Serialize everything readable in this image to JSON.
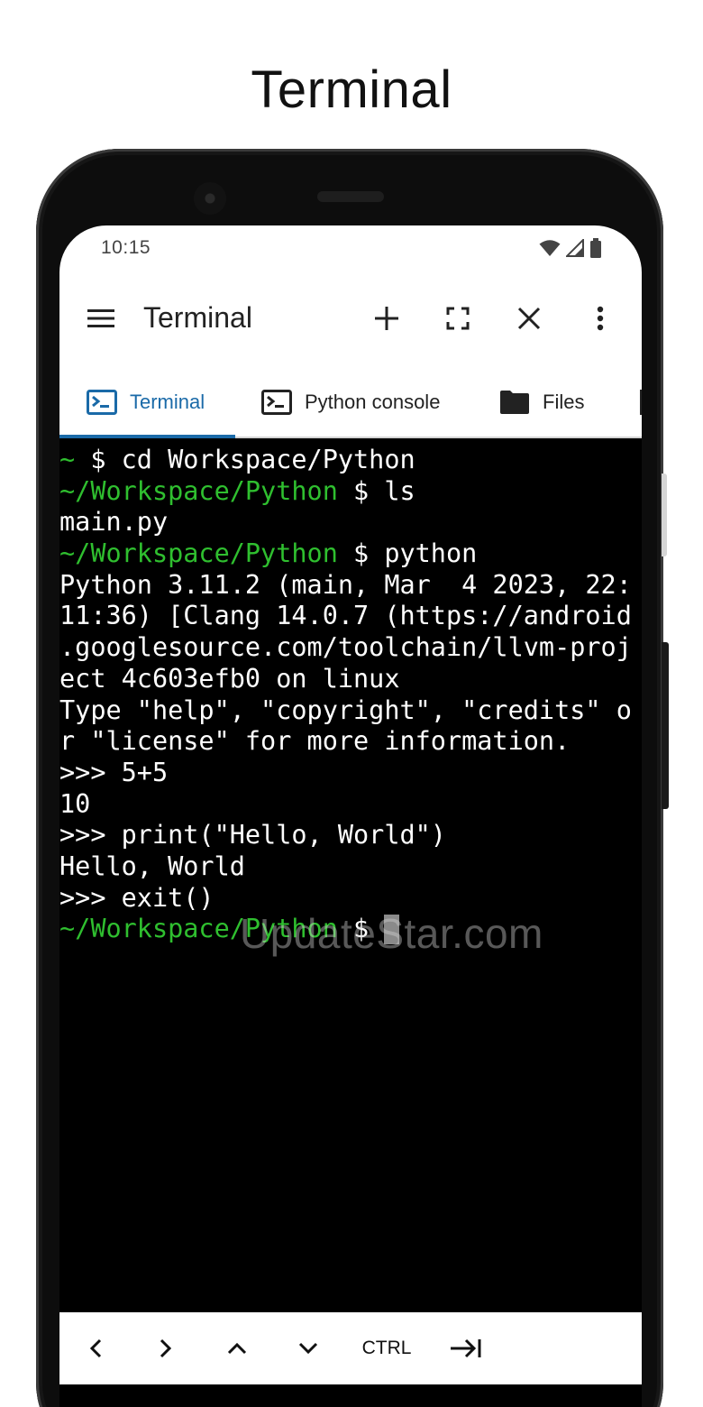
{
  "caption": "Terminal",
  "status_bar": {
    "time": "10:15",
    "icons": [
      "wifi-icon",
      "signal-icon",
      "battery-icon"
    ]
  },
  "toolbar": {
    "title": "Terminal",
    "actions": [
      "menu-icon",
      "add-icon",
      "fullscreen-icon",
      "close-icon",
      "more-vert-icon"
    ]
  },
  "tabs": [
    {
      "label": "Terminal",
      "icon": "terminal-icon",
      "active": true
    },
    {
      "label": "Python console",
      "icon": "terminal-icon",
      "active": false
    },
    {
      "label": "Files",
      "icon": "folder-icon",
      "active": false
    }
  ],
  "terminal": {
    "lines": [
      [
        {
          "t": "~ ",
          "c": "green"
        },
        {
          "t": "$ cd Workspace/Python",
          "c": "white"
        }
      ],
      [
        {
          "t": "~/Workspace/Python",
          "c": "green"
        },
        {
          "t": " $ ls",
          "c": "white"
        }
      ],
      [
        {
          "t": "main.py",
          "c": "white"
        }
      ],
      [
        {
          "t": "~/Workspace/Python",
          "c": "green"
        },
        {
          "t": " $ python",
          "c": "white"
        }
      ],
      [
        {
          "t": "Python 3.11.2 (main, Mar  4 2023, 22:",
          "c": "white"
        }
      ],
      [
        {
          "t": "11:36) [Clang 14.0.7 (https://android",
          "c": "white"
        }
      ],
      [
        {
          "t": ".googlesource.com/toolchain/llvm-proj",
          "c": "white"
        }
      ],
      [
        {
          "t": "ect 4c603efb0 on linux",
          "c": "white"
        }
      ],
      [
        {
          "t": "Type \"help\", \"copyright\", \"credits\" o",
          "c": "white"
        }
      ],
      [
        {
          "t": "r \"license\" for more information.",
          "c": "white"
        }
      ],
      [
        {
          "t": ">>> 5+5",
          "c": "white"
        }
      ],
      [
        {
          "t": "10",
          "c": "white"
        }
      ],
      [
        {
          "t": ">>> print(\"Hello, World\")",
          "c": "white"
        }
      ],
      [
        {
          "t": "Hello, World",
          "c": "white"
        }
      ],
      [
        {
          "t": ">>> exit()",
          "c": "white"
        }
      ],
      [
        {
          "t": "~/Workspace/Python",
          "c": "green"
        },
        {
          "t": " $ ",
          "c": "white"
        }
      ]
    ]
  },
  "watermark": "UpdateStar.com",
  "extra_keys": [
    {
      "name": "left-arrow-key",
      "icon": "chevron-left-icon"
    },
    {
      "name": "right-arrow-key",
      "icon": "chevron-right-icon"
    },
    {
      "name": "up-arrow-key",
      "icon": "chevron-up-icon"
    },
    {
      "name": "down-arrow-key",
      "icon": "chevron-down-icon"
    },
    {
      "name": "ctrl-key",
      "label": "CTRL"
    },
    {
      "name": "tab-key",
      "icon": "tab-icon"
    }
  ],
  "colors": {
    "accent": "#1a6aa8",
    "prompt_green": "#2fbf2f",
    "terminal_bg": "#000000",
    "cursor": "#8a8a8a"
  }
}
